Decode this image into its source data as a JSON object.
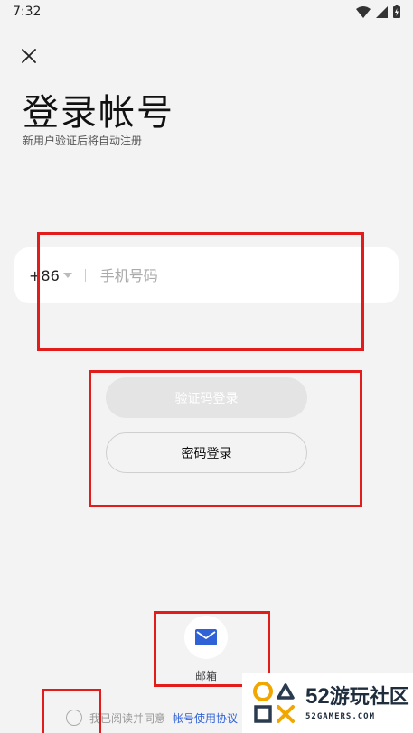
{
  "status_bar": {
    "time": "7:32"
  },
  "header": {
    "title": "登录帐号",
    "subtitle": "新用户验证后将自动注册"
  },
  "phone": {
    "country_code": "+86",
    "placeholder": "手机号码",
    "value": ""
  },
  "buttons": {
    "code_login": "验证码登录",
    "password_login": "密码登录"
  },
  "alt_login": {
    "email_label": "邮箱",
    "email_icon": "mail-icon"
  },
  "agreement": {
    "prefix": "我已阅读并同意",
    "link": "帐号使用协议"
  },
  "watermark": {
    "brand_num": "52",
    "brand_text": "游玩社区",
    "domain": "52GAMERS.COM"
  },
  "colors": {
    "background": "#f3f3f3",
    "card": "#ffffff",
    "link": "#2f62d6",
    "annotation": "#e21b1b",
    "disabled_button": "#e4e4e4"
  }
}
